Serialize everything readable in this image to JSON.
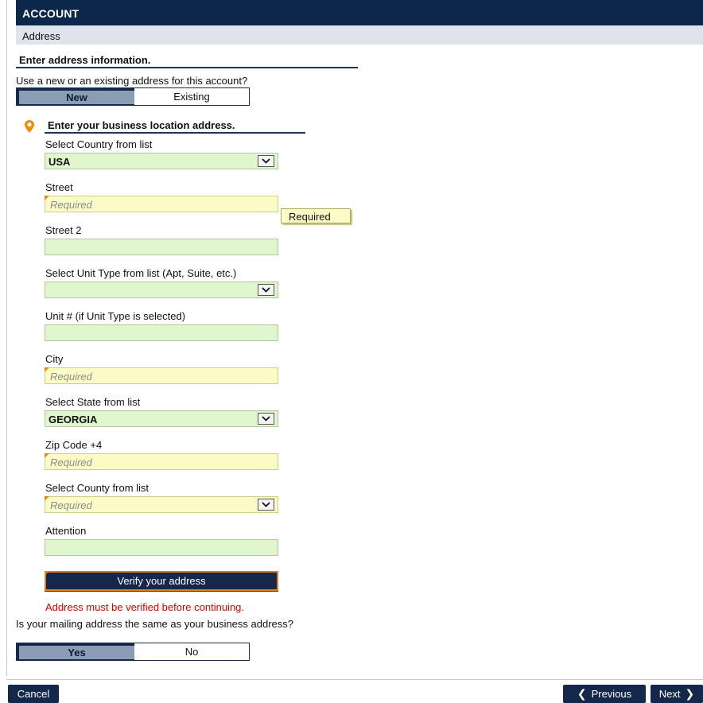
{
  "header": {
    "title": "ACCOUNT",
    "subtitle": "Address"
  },
  "section": {
    "title": "Enter address information.",
    "question": "Use a new or an existing address for this account?",
    "toggle": {
      "options": [
        "New",
        "Existing"
      ],
      "selected": "New"
    }
  },
  "location": {
    "title": "Enter your business location address.",
    "icon": "map-pin-icon",
    "fields": {
      "country": {
        "label": "Select Country from list",
        "value": "USA"
      },
      "street": {
        "label": "Street",
        "placeholder": "Required",
        "tooltip": "Required"
      },
      "street2": {
        "label": "Street 2"
      },
      "unit_type": {
        "label": "Select Unit Type from list (Apt, Suite, etc.)"
      },
      "unit_number": {
        "label": "Unit # (if Unit Type is selected)"
      },
      "city": {
        "label": "City",
        "placeholder": "Required"
      },
      "state": {
        "label": "Select State from list",
        "value": "GEORGIA"
      },
      "zip": {
        "label": "Zip Code +4",
        "placeholder": "Required"
      },
      "county": {
        "label": "Select County from list",
        "placeholder": "Required"
      },
      "attention": {
        "label": "Attention"
      }
    },
    "verify_label": "Verify your address",
    "error": "Address must be verified before continuing."
  },
  "mailing": {
    "question": "Is your mailing address the same as your business address?",
    "toggle": {
      "options": [
        "Yes",
        "No"
      ],
      "selected": "Yes"
    }
  },
  "footer": {
    "cancel": "Cancel",
    "previous": "Previous",
    "next": "Next"
  },
  "colors": {
    "navy": "#0c2749",
    "accent": "#e58a12",
    "error": "#e00000",
    "field_valid": "#e0f6cf",
    "field_required": "#fbfbc6"
  }
}
